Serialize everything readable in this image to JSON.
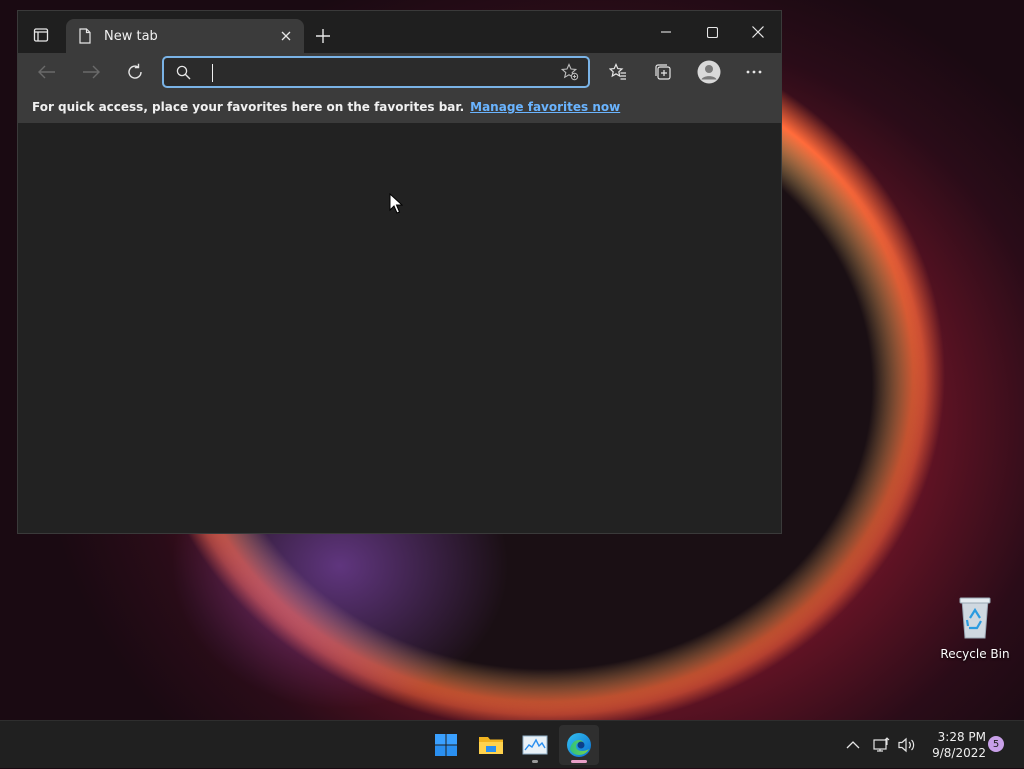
{
  "browser": {
    "tab": {
      "title": "New tab"
    },
    "address": {
      "value": "",
      "placeholder": ""
    },
    "favorites_bar": {
      "message": "For quick access, place your favorites here on the favorites bar.",
      "link": "Manage favorites now"
    }
  },
  "desktop": {
    "recycle_bin": {
      "label": "Recycle Bin"
    }
  },
  "taskbar": {
    "apps": [
      "start-icon",
      "file-explorer-icon",
      "task-manager-icon",
      "edge-icon"
    ],
    "clock": {
      "time": "3:28 PM",
      "date": "9/8/2022"
    },
    "notification_count": "5"
  },
  "colors": {
    "accent": "#7ab3e6",
    "link": "#6ab4ff",
    "browser_bg": "#222222",
    "taskbar_bg": "#202020"
  }
}
